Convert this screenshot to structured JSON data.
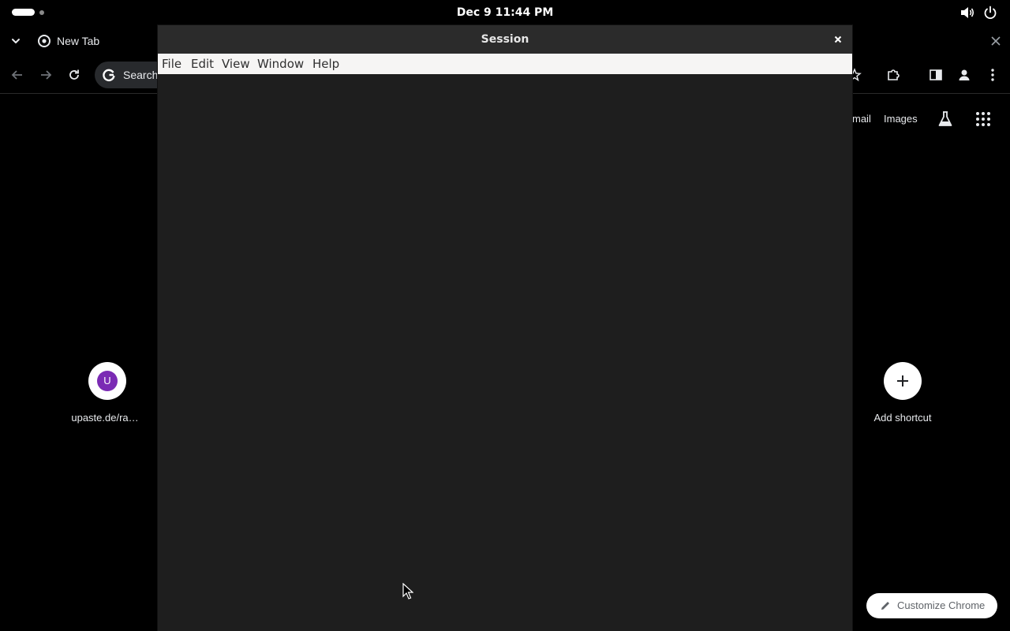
{
  "topbar": {
    "clock": "Dec 9  11:44 PM",
    "icons": [
      "volume-icon",
      "power-icon"
    ]
  },
  "chrome": {
    "tab": {
      "title": "New Tab"
    },
    "omnibox": {
      "placeholder": "Search"
    },
    "ntp": {
      "gmail_label": "mail",
      "images_label": "Images",
      "shortcuts": [
        {
          "letter": "U",
          "label": "upaste.de/ra…"
        },
        {
          "label": "Add shortcut"
        }
      ],
      "customize_label": "Customize Chrome"
    }
  },
  "session_window": {
    "title": "Session",
    "menu": [
      "File",
      "Edit",
      "View",
      "Window",
      "Help"
    ]
  },
  "colors": {
    "shortcut_avatar": "#7b2bb4",
    "terminal_bg": "#1e1e1e",
    "menubar_bg": "#f6f5f4"
  }
}
